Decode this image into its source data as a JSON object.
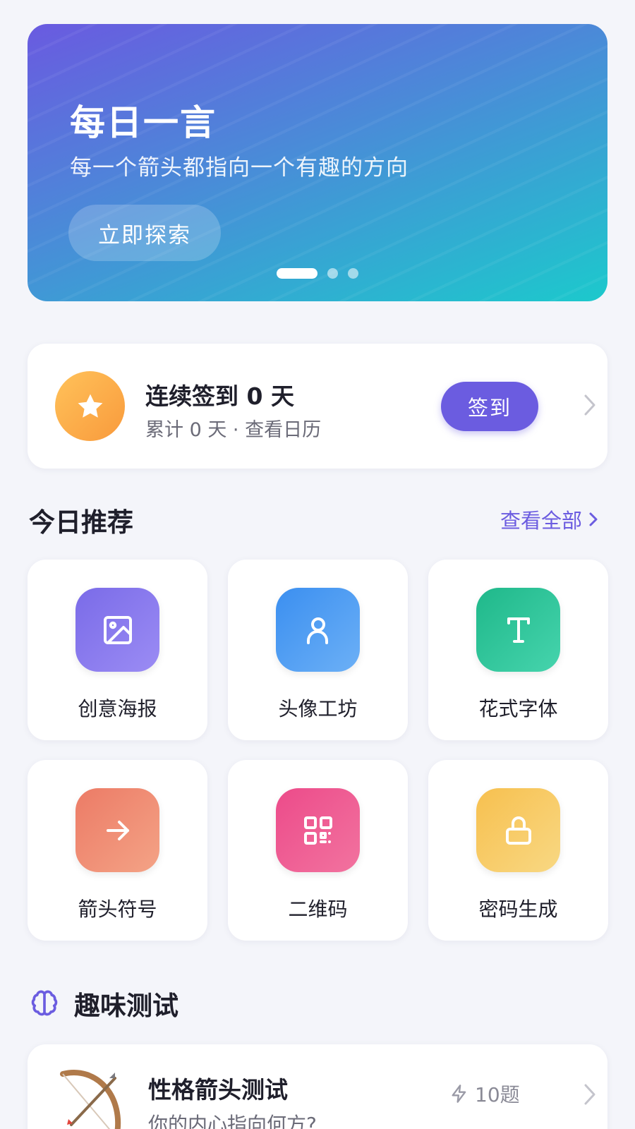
{
  "banner": {
    "title": "每日一言",
    "subtitle": "每一个箭头都指向一个有趣的方向",
    "button_label": "立即探索",
    "slides_count": 3,
    "active_slide": 1
  },
  "checkin": {
    "title": "连续签到 0 天",
    "subtitle": "累计 0 天 · 查看日历",
    "button_label": "签到",
    "icon": "star-icon"
  },
  "recommend": {
    "title": "今日推荐",
    "see_all_label": "查看全部",
    "tools": [
      {
        "label": "创意海报",
        "icon": "image-icon",
        "color_from": "#7a6be8",
        "color_to": "#9b8cf4"
      },
      {
        "label": "头像工坊",
        "icon": "user-icon",
        "color_from": "#3b8ff0",
        "color_to": "#6cb0f6"
      },
      {
        "label": "花式字体",
        "icon": "text-t-icon",
        "color_from": "#1fb88a",
        "color_to": "#46d4ad"
      },
      {
        "label": "箭头符号",
        "icon": "arrow-right-icon",
        "color_from": "#ec7b66",
        "color_to": "#f4a386"
      },
      {
        "label": "二维码",
        "icon": "qr-code-icon",
        "color_from": "#ec4b8a",
        "color_to": "#f2739f"
      },
      {
        "label": "密码生成",
        "icon": "lock-icon",
        "color_from": "#f7c04f",
        "color_to": "#f8d883"
      }
    ]
  },
  "fun_tests": {
    "title": "趣味测试",
    "icon": "brain-icon",
    "items": [
      {
        "title": "性格箭头测试",
        "subtitle": "你的内心指向何方?",
        "count_label": "10题",
        "icon": "bow-arrow-icon"
      }
    ]
  },
  "colors": {
    "accent": "#6b5ce0",
    "background": "#f4f5fa",
    "star_badge": "#f9a944"
  }
}
